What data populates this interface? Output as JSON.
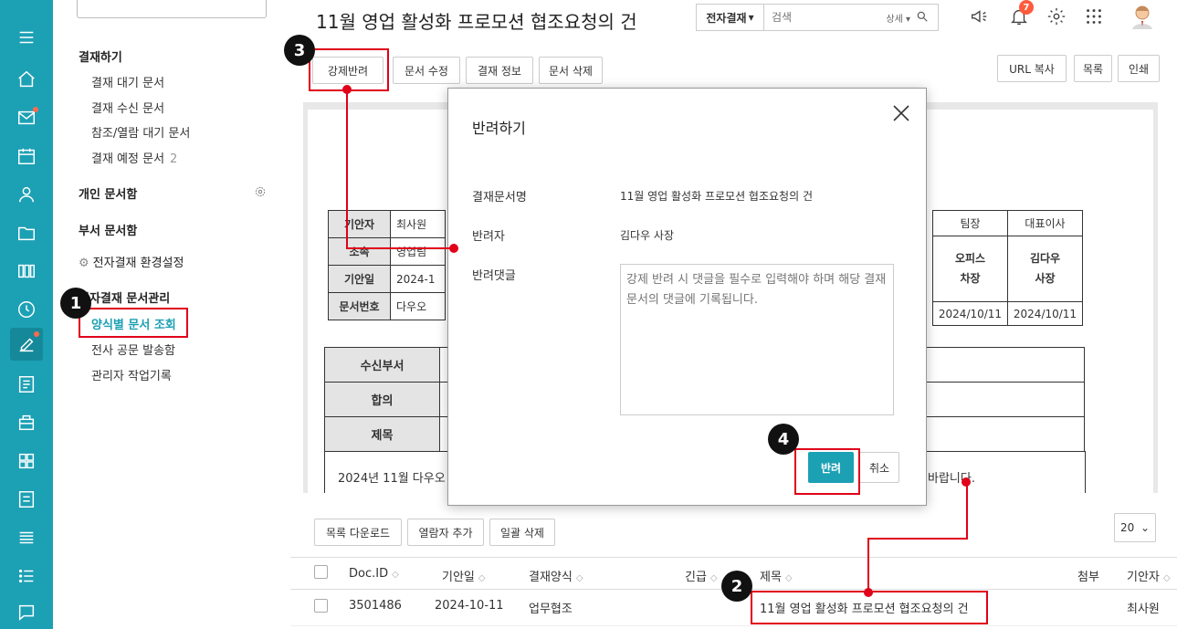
{
  "rail": {
    "icons": [
      "menu-icon",
      "home-icon",
      "mail-icon",
      "calendar-icon",
      "user-icon",
      "folder-icon",
      "board-icon",
      "clock-icon",
      "approval-icon",
      "report-icon",
      "resource-icon",
      "apps-icon",
      "survey-icon",
      "list-icon",
      "todo-icon",
      "chat-icon"
    ]
  },
  "menu": {
    "section_approve": "결재하기",
    "approve_items": [
      "결재 대기 문서",
      "결재 수신 문서",
      "참조/열람 대기 문서",
      "결재 예정 문서"
    ],
    "approve_count": "2",
    "personal_box": "개인 문서함",
    "dept_box": "부서 문서함",
    "settings": "전자결재 환경설정",
    "admin_section": "전자결재 문서관리",
    "admin_items": [
      "양식별 문서 조회",
      "전사 공문 발송함",
      "관리자 작업기록"
    ]
  },
  "header": {
    "title": "11월 영업 활성화 프로모션 협조요청의 건",
    "search_scope": "전자결재",
    "search_placeholder": "검색",
    "search_detail": "상세",
    "notification_count": "7"
  },
  "toolbar": {
    "force_reject": "강제반려",
    "edit_doc": "문서 수정",
    "approval_info": "결재 정보",
    "delete_doc": "문서 삭제",
    "url_copy": "URL 복사",
    "list": "목록",
    "print": "인쇄"
  },
  "document": {
    "rows": [
      {
        "label": "기안자",
        "value": "최사원"
      },
      {
        "label": "소속",
        "value": "영업팀"
      },
      {
        "label": "기안일",
        "value": "2024-1"
      },
      {
        "label": "문서번호",
        "value": "다우오"
      }
    ],
    "sign_headers": [
      "팀장",
      "대표이사"
    ],
    "sign_names": [
      "오피스\n차장",
      "김다우\n사장"
    ],
    "sign_dates": [
      "2024/10/11",
      "2024/10/11"
    ],
    "recv_labels": [
      "수신부서",
      "합의",
      "제목"
    ],
    "body_start": "2024년 11월 다우오",
    "body_end": "바랍니다."
  },
  "list_toolbar": {
    "download": "목록 다운로드",
    "add_viewer": "열람자 추가",
    "bulk_delete": "일괄 삭제",
    "page_size": "20"
  },
  "table": {
    "headers": [
      "Doc.ID",
      "기안일",
      "결재양식",
      "긴급",
      "제목",
      "첨부",
      "기안자"
    ],
    "rows": [
      {
        "doc_id": "3501486",
        "date": "2024-10-11",
        "form": "업무협조",
        "title": "11월 영업 활성화 프로모션 협조요청의 건",
        "drafter": "최사원"
      }
    ]
  },
  "modal": {
    "title": "반려하기",
    "doc_name_label": "결재문서명",
    "doc_name_value": "11월 영업 활성화 프로모션 협조요청의 건",
    "rejecter_label": "반려자",
    "rejecter_value": "김다우 사장",
    "comment_label": "반려댓글",
    "comment_placeholder": "강제 반려 시 댓글을 필수로 입력해야 하며 해당 결재문서의 댓글에 기록됩니다.",
    "reject_button": "반려",
    "cancel_button": "취소"
  },
  "steps": [
    "1",
    "2",
    "3",
    "4"
  ],
  "colors": {
    "accent": "#1ca0b4",
    "annotation": "#e0001a"
  }
}
